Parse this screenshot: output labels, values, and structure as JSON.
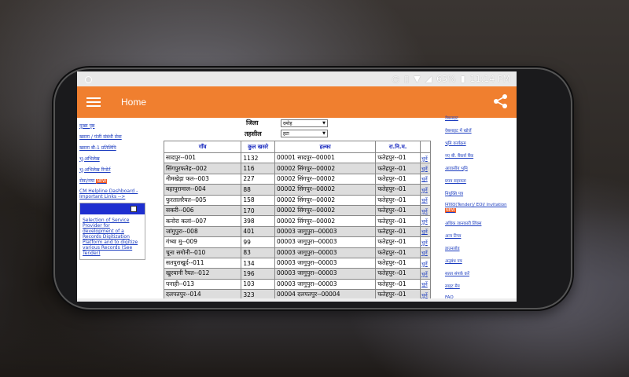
{
  "status_bar": {
    "battery": "65%",
    "time": "11:14 PM"
  },
  "app_bar": {
    "title": "Home"
  },
  "left_links": [
    "मुख्य पृष्ठ",
    "खसरा / पंजी संबंधी सेवा",
    "खसरा बी-1 प्रतिलिपि",
    "भू-अभिलेख",
    "भू-अभिलेख रिपोर्ट",
    "सेवा/नया"
  ],
  "left_new_badge": "NEW",
  "helpline_text": "CM Helpline Dashboard - Important Links -->",
  "notice_text": "Selection of Service Provider for development of a Records Digitization Platform and to digitize various Records (See Tender)",
  "filters": {
    "district_label": "जिला",
    "district_value": "दमोह",
    "tehsil_label": "तहसील",
    "tehsil_value": "हटा"
  },
  "table": {
    "headers": [
      "गाँव",
      "कुल खसरे",
      "हल्का",
      "रा.नि.म.",
      ""
    ],
    "rows": [
      [
        "सादपुर--001",
        "1132",
        "00001 सादपुर--00001",
        "फतेहपुर--01",
        "चुनें"
      ],
      [
        "सिंगपुरफतेह--002",
        "116",
        "00002 सिंगपुर--00002",
        "फतेहपुर--01",
        "चुनें"
      ],
      [
        "नीमखेड़ा फत--003",
        "227",
        "00002 सिंगपुर--00002",
        "फतेहपुर--01",
        "चुनें"
      ],
      [
        "बहापुरामाल--004",
        "88",
        "00002 सिंगपुर--00002",
        "फतेहपुर--01",
        "चुनें"
      ],
      [
        "फुरतालरैयत--005",
        "158",
        "00002 सिंगपुर--00002",
        "फतेहपुर--01",
        "चुनें"
      ],
      [
        "सकरी--006",
        "170",
        "00002 सिंगपुर--00002",
        "फतेहपुर--01",
        "चुनें"
      ],
      [
        "कनोरा कलां--007",
        "398",
        "00002 सिंगपुर--00002",
        "फतेहपुर--01",
        "चुनें"
      ],
      [
        "जांगुपुरा--008",
        "401",
        "00003 जागुपुरा--00003",
        "फतेहपुर--01",
        "चुनें"
      ],
      [
        "गंभ्वा मु--009",
        "99",
        "00003 जागुपुरा--00003",
        "फतेहपुर--01",
        "चुनें"
      ],
      [
        "चूना सगोनी--010",
        "83",
        "00003 जागुपुरा--00003",
        "फतेहपुर--01",
        "चुनें"
      ],
      [
        "सतपुराखुर्द--011",
        "134",
        "00003 जागुपुरा--00003",
        "फतेहपुर--01",
        "चुनें"
      ],
      [
        "खुरयानी रैयत--012",
        "196",
        "00003 जागुपुरा--00003",
        "फतेहपुर--01",
        "चुनें"
      ],
      [
        "पनाही--013",
        "103",
        "00003 जागुपुरा--00003",
        "फतेहपुर--01",
        "चुनें"
      ],
      [
        "दलपतपुर--014",
        "323",
        "00004 दलपतपुर--00004",
        "फतेहपुर--01",
        "चुनें"
      ]
    ]
  },
  "right_links": [
    "वेबसाइट",
    "वेबसाइट में खोजें",
    "भूमि कार्यक्रम",
    "नए बी. बैंकर्स बैंक",
    "आवासीय भूमि",
    "प्रपत्र सहायता",
    "नियुक्ति पत्र",
    "निविदा(Tender)/ EOI/ Invitation",
    "अधिक जानकारी लिंक्स",
    "अन्य टिप्स",
    "डाउनलोड",
    "अनुबंध पत्र",
    "सतत संपर्क करें",
    "साइट मैप",
    "FAQ"
  ],
  "right_new_badge": "NEW"
}
